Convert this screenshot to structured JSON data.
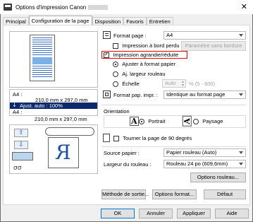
{
  "window": {
    "title": "Options d'impression Canon"
  },
  "tabs": [
    {
      "label": "Principal"
    },
    {
      "label": "Configuration de la page"
    },
    {
      "label": "Disposition"
    },
    {
      "label": "Favoris"
    },
    {
      "label": "Entretien"
    }
  ],
  "preview": {
    "paper_label": "A4 :",
    "paper_size": "210,0 mm x 297,0 mm",
    "adjust": "Ajust. auto : 100%",
    "output_label": "A4 :",
    "output_size": "210,0 mm x 297,0 mm"
  },
  "page_size": {
    "label": "Format page :",
    "value": "A4"
  },
  "borderless": {
    "label": "Impression à bord perdu",
    "checked": false,
    "settings_button": "Paramètre sans bordure"
  },
  "scaled": {
    "label": "Impression agrandie/réduite",
    "checked": true,
    "highlight": "#e00000"
  },
  "scale_options": [
    {
      "label": "Ajuster à format papier",
      "selected": true
    },
    {
      "label": "Aj. largeur rouleau",
      "selected": false
    },
    {
      "label": "Échelle",
      "selected": false
    }
  ],
  "scale": {
    "value": "Auto",
    "range": "% (5 - 600)"
  },
  "printer_paper": {
    "label": "Format pap. impr. :",
    "value": "Identique au format page"
  },
  "orientation": {
    "label": "Orientation",
    "portrait": "Portrait",
    "landscape": "Paysage",
    "portrait_selected": true
  },
  "rotate": {
    "label": "Tourner la page de 90 degrés",
    "checked": false
  },
  "paper_source": {
    "label": "Source papier :",
    "value": "Papier rouleau (Auto)"
  },
  "roll_width": {
    "label": "Largeur du rouleau :",
    "value": "Rouleau 24 po (609,6mm)"
  },
  "buttons": {
    "roll_options": "Options rouleau...",
    "output_method": "Méthode de sortie...",
    "format_options": "Options format...",
    "defaults": "Défaut",
    "ok": "OK",
    "cancel": "Annuler",
    "apply": "Appliquer",
    "help": "Aide"
  }
}
